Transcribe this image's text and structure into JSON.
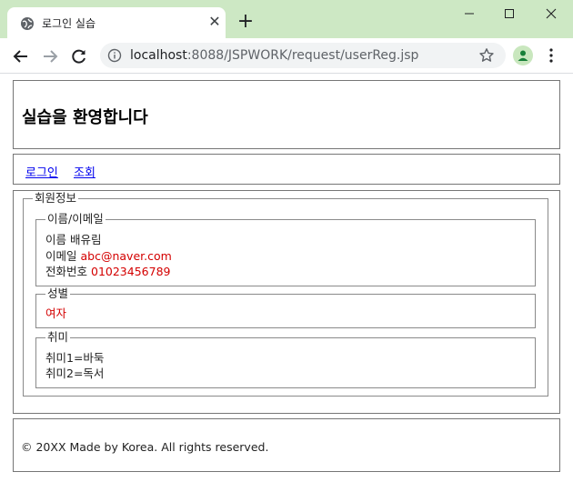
{
  "browser": {
    "tab_title": "로그인 실습",
    "url_host": "localhost",
    "url_path": ":8088/JSPWORK/request/userReg.jsp"
  },
  "header": {
    "title": "실습을 환영합니다"
  },
  "nav": {
    "login": "로그인",
    "view": "조회"
  },
  "member_info": {
    "legend": "회원정보",
    "name_email": {
      "legend": "이름/이메일",
      "name_label": "이름",
      "name_value": "배유림",
      "email_label": "이메일",
      "email_value": "abc@naver.com",
      "phone_label": "전화번호",
      "phone_value": "01023456789"
    },
    "gender": {
      "legend": "성별",
      "value": "여자"
    },
    "hobby": {
      "legend": "취미",
      "items": [
        "취미1=바둑",
        "취미2=독서"
      ]
    }
  },
  "footer": {
    "text": "© 20XX Made by Korea. All rights reserved."
  },
  "colors": {
    "titlebar": "#cde8c4",
    "value_text": "#d40000",
    "link": "#0000ee"
  }
}
